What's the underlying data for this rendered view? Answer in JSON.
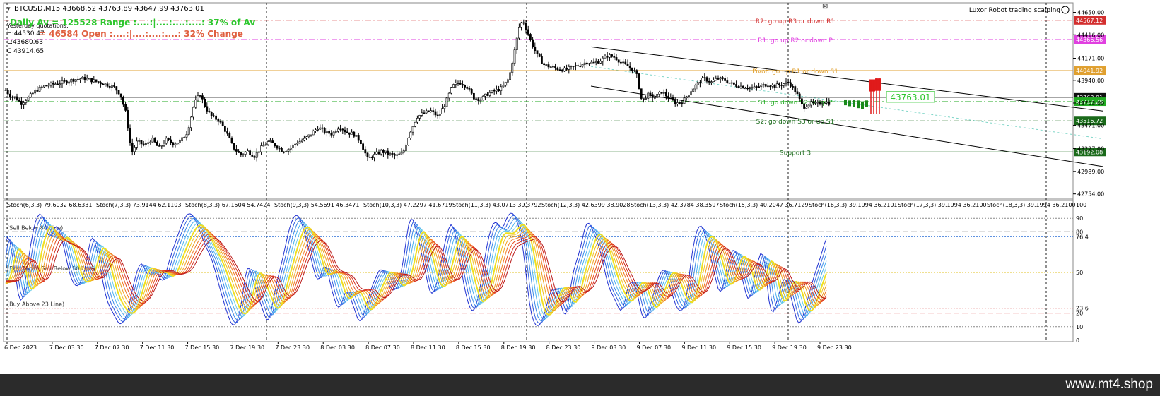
{
  "window": {
    "title": "BTCUSD,M15  43668.52 43763.89 43647.99 43763.01",
    "indicator_name": "Luxor Robot trading scalping",
    "smile_icon": "smile-icon",
    "close_icon": "close-icon",
    "dropdown_icon": "triangle-down-icon"
  },
  "overlay": {
    "yesterday_label": "Yesterday quotations:",
    "high": "H:44530.47",
    "low": "L:43680.63",
    "close": "C 43914.65",
    "line1": "Daily Av = 125528  Range :....:|....:....:....:  37% of Av",
    "line2": "= 46584  Open :....:|....:....:....:  32% Change"
  },
  "colors": {
    "resistance": "#d32f2f",
    "magenta": "#e040e0",
    "pivot": "#e0a030",
    "support": "#22aa22",
    "support_dark": "#1a6a1a",
    "current": "#111111",
    "accent_green": "#2ec62e"
  },
  "levels": [
    {
      "id": "r2",
      "price": 44567.12,
      "tag": "44567.12",
      "label": "R2: go up R3 or down R1",
      "color": "#d32f2f",
      "style": "dashdot"
    },
    {
      "id": "r1",
      "price": 44366.56,
      "tag": "44366.56",
      "label": "R1: go up R2 or down P",
      "color": "#e040e0",
      "style": "dashdot"
    },
    {
      "id": "pivot",
      "price": 44041.92,
      "tag": "44041.92",
      "label": "Pivot: go up R1 or down S1",
      "color": "#e0a030",
      "style": "solid"
    },
    {
      "id": "current",
      "price": 43763.01,
      "tag": "43763.01",
      "label": "",
      "color": "#111111",
      "style": "solid"
    },
    {
      "id": "s1",
      "price": 43717.28,
      "tag": "43717.28",
      "label": "S1: go down S2 or up P",
      "color": "#22aa22",
      "style": "dashdot"
    },
    {
      "id": "s2",
      "price": 43516.72,
      "tag": "43516.72",
      "label": "S2: go down S3 or up S1",
      "color": "#1a6a1a",
      "style": "dashdot"
    },
    {
      "id": "s3",
      "price": 43192.08,
      "tag": "43192.08",
      "label": "Support 3",
      "color": "#1a6a1a",
      "style": "solid"
    }
  ],
  "price_box": "43763.01",
  "chart_data": [
    {
      "type": "candlestick",
      "title": "BTCUSD,M15",
      "ylim": [
        42700,
        44750
      ],
      "y_ticks": [
        44650.0,
        44416.0,
        44171.0,
        43940.0,
        43703.0,
        43471.0,
        43227.0,
        42989.0,
        42754.0
      ],
      "x_labels": [
        "6 Dec 2023",
        "7 Dec 03:30",
        "7 Dec 07:30",
        "7 Dec 11:30",
        "7 Dec 15:30",
        "7 Dec 19:30",
        "7 Dec 23:30",
        "8 Dec 03:30",
        "8 Dec 07:30",
        "8 Dec 11:30",
        "8 Dec 15:30",
        "8 Dec 19:30",
        "8 Dec 23:30",
        "9 Dec 03:30",
        "9 Dec 07:30",
        "9 Dec 11:30",
        "9 Dec 15:30",
        "9 Dec 19:30",
        "9 Dec 23:30"
      ],
      "close_path": [
        [
          0,
          43770
        ],
        [
          8,
          43840
        ],
        [
          14,
          43780
        ],
        [
          22,
          43760
        ],
        [
          30,
          43700
        ],
        [
          40,
          43760
        ],
        [
          50,
          43830
        ],
        [
          62,
          43880
        ],
        [
          75,
          43900
        ],
        [
          90,
          43920
        ],
        [
          105,
          43950
        ],
        [
          120,
          43960
        ],
        [
          135,
          43930
        ],
        [
          148,
          43900
        ],
        [
          160,
          43880
        ],
        [
          170,
          43800
        ],
        [
          178,
          43600
        ],
        [
          186,
          43180
        ],
        [
          194,
          43300
        ],
        [
          205,
          43260
        ],
        [
          215,
          43330
        ],
        [
          225,
          43230
        ],
        [
          235,
          43320
        ],
        [
          245,
          43280
        ],
        [
          255,
          43300
        ],
        [
          265,
          43400
        ],
        [
          275,
          43700
        ],
        [
          283,
          43800
        ],
        [
          291,
          43650
        ],
        [
          300,
          43560
        ],
        [
          310,
          43520
        ],
        [
          320,
          43400
        ],
        [
          330,
          43240
        ],
        [
          340,
          43160
        ],
        [
          350,
          43200
        ],
        [
          360,
          43150
        ],
        [
          370,
          43240
        ],
        [
          380,
          43300
        ],
        [
          390,
          43260
        ],
        [
          400,
          43200
        ],
        [
          410,
          43230
        ],
        [
          420,
          43290
        ],
        [
          430,
          43320
        ],
        [
          440,
          43380
        ],
        [
          450,
          43450
        ],
        [
          460,
          43400
        ],
        [
          470,
          43380
        ],
        [
          480,
          43460
        ],
        [
          490,
          43400
        ],
        [
          500,
          43380
        ],
        [
          510,
          43300
        ],
        [
          520,
          43120
        ],
        [
          530,
          43160
        ],
        [
          540,
          43200
        ],
        [
          550,
          43170
        ],
        [
          560,
          43150
        ],
        [
          570,
          43180
        ],
        [
          580,
          43400
        ],
        [
          590,
          43560
        ],
        [
          600,
          43600
        ],
        [
          610,
          43620
        ],
        [
          620,
          43560
        ],
        [
          630,
          43700
        ],
        [
          640,
          43880
        ],
        [
          650,
          43920
        ],
        [
          660,
          43880
        ],
        [
          670,
          43760
        ],
        [
          680,
          43740
        ],
        [
          690,
          43800
        ],
        [
          700,
          43830
        ],
        [
          710,
          43860
        ],
        [
          720,
          43960
        ],
        [
          728,
          44250
        ],
        [
          735,
          44520
        ],
        [
          740,
          44560
        ],
        [
          746,
          44450
        ],
        [
          752,
          44330
        ],
        [
          760,
          44200
        ],
        [
          770,
          44100
        ],
        [
          780,
          44080
        ],
        [
          790,
          44060
        ],
        [
          800,
          44050
        ],
        [
          810,
          44080
        ],
        [
          820,
          44100
        ],
        [
          830,
          44130
        ],
        [
          840,
          44120
        ],
        [
          850,
          44150
        ],
        [
          860,
          44200
        ],
        [
          870,
          44180
        ],
        [
          880,
          44120
        ],
        [
          890,
          44080
        ],
        [
          900,
          44020
        ],
        [
          908,
          43720
        ],
        [
          916,
          43790
        ],
        [
          926,
          43760
        ],
        [
          936,
          43820
        ],
        [
          946,
          43760
        ],
        [
          956,
          43700
        ],
        [
          966,
          43720
        ],
        [
          976,
          43820
        ],
        [
          986,
          43900
        ],
        [
          996,
          43960
        ],
        [
          1006,
          43920
        ],
        [
          1016,
          43960
        ],
        [
          1026,
          43940
        ],
        [
          1036,
          43900
        ],
        [
          1046,
          43880
        ],
        [
          1056,
          43870
        ],
        [
          1066,
          43860
        ],
        [
          1076,
          43880
        ],
        [
          1086,
          43900
        ],
        [
          1096,
          43880
        ],
        [
          1106,
          43900
        ],
        [
          1116,
          43920
        ],
        [
          1126,
          43820
        ],
        [
          1136,
          43660
        ],
        [
          1146,
          43700
        ],
        [
          1156,
          43690
        ],
        [
          1166,
          43720
        ],
        [
          1175,
          43700
        ]
      ],
      "signal_bars": [
        {
          "x": 1196,
          "low": 43680,
          "high": 43740,
          "color": "#1a8a1a"
        },
        {
          "x": 1202,
          "low": 43670,
          "high": 43730,
          "color": "#1a8a1a"
        },
        {
          "x": 1208,
          "low": 43660,
          "high": 43740,
          "color": "#1a8a1a"
        },
        {
          "x": 1214,
          "low": 43650,
          "high": 43730,
          "color": "#1a8a1a"
        },
        {
          "x": 1220,
          "low": 43640,
          "high": 43720,
          "color": "#1a8a1a"
        },
        {
          "x": 1226,
          "low": 43660,
          "high": 43730,
          "color": "#1a8a1a"
        },
        {
          "x": 1234,
          "low": 43590,
          "high": 43950,
          "color": "#e01b1b"
        },
        {
          "x": 1242,
          "low": 43590,
          "high": 43960,
          "color": "#e01b1b"
        }
      ],
      "channel": {
        "upper": [
          [
            836,
            44290
          ],
          [
            1560,
            43620
          ]
        ],
        "lower": [
          [
            836,
            43880
          ],
          [
            1560,
            43040
          ]
        ],
        "mid": [
          [
            836,
            44085
          ],
          [
            1560,
            43330
          ]
        ]
      }
    },
    {
      "type": "line",
      "title": "Stochastic ribbon",
      "ylim": [
        0,
        100
      ],
      "y_ticks": [
        100,
        90,
        80,
        76.4,
        50,
        23.6,
        20,
        10,
        0
      ],
      "stoch_headers": [
        "Stoch(6,3,3) 79.6032 68.6331",
        "Stoch(7,3,3) 73.9144 62.1103",
        "Stoch(8,3,3) 67.1504 54.7424",
        "Stoch(9,3,3) 54.5691 46.3471",
        "Stoch(10,3,3) 47.2297 41.6719",
        "Stoch(11,3,3) 43.0713 39.3792",
        "Stoch(12,3,3) 42.6399 38.9028",
        "Stoch(13,3,3) 42.3784 38.3597",
        "Stoch(15,3,3) 40.2047 36.7129",
        "Stoch(16,3,3) 39.1994 36.2101",
        "Stoch(17,3,3) 39.1994 36.2100",
        "Stoch(18,3,3) 39.1994 36.2100"
      ],
      "line_labels": {
        "sell_below": "Sell Below 80 Line",
        "buy_above_sell_below": "Buy Above Sell Below 50 Line",
        "buy_above": "Buy Above 23 Line"
      },
      "fast_path": [
        [
          0,
          40
        ],
        [
          10,
          85
        ],
        [
          20,
          55
        ],
        [
          30,
          20
        ],
        [
          40,
          60
        ],
        [
          50,
          90
        ],
        [
          60,
          95
        ],
        [
          70,
          72
        ],
        [
          80,
          88
        ],
        [
          90,
          70
        ],
        [
          100,
          45
        ],
        [
          110,
          38
        ],
        [
          120,
          50
        ],
        [
          130,
          82
        ],
        [
          140,
          60
        ],
        [
          150,
          30
        ],
        [
          160,
          20
        ],
        [
          170,
          10
        ],
        [
          180,
          18
        ],
        [
          190,
          45
        ],
        [
          200,
          60
        ],
        [
          210,
          45
        ],
        [
          220,
          55
        ],
        [
          230,
          40
        ],
        [
          240,
          60
        ],
        [
          250,
          75
        ],
        [
          260,
          90
        ],
        [
          270,
          95
        ],
        [
          280,
          85
        ],
        [
          290,
          70
        ],
        [
          300,
          60
        ],
        [
          310,
          40
        ],
        [
          320,
          22
        ],
        [
          330,
          8
        ],
        [
          340,
          20
        ],
        [
          350,
          60
        ],
        [
          360,
          40
        ],
        [
          370,
          25
        ],
        [
          380,
          10
        ],
        [
          390,
          40
        ],
        [
          400,
          60
        ],
        [
          410,
          85
        ],
        [
          420,
          95
        ],
        [
          430,
          82
        ],
        [
          440,
          60
        ],
        [
          450,
          40
        ],
        [
          460,
          60
        ],
        [
          470,
          35
        ],
        [
          480,
          20
        ],
        [
          490,
          40
        ],
        [
          500,
          25
        ],
        [
          510,
          10
        ],
        [
          520,
          30
        ],
        [
          530,
          45
        ],
        [
          540,
          55
        ],
        [
          550,
          40
        ],
        [
          560,
          35
        ],
        [
          570,
          55
        ],
        [
          580,
          95
        ],
        [
          590,
          80
        ],
        [
          600,
          55
        ],
        [
          610,
          30
        ],
        [
          620,
          45
        ],
        [
          630,
          75
        ],
        [
          640,
          90
        ],
        [
          650,
          60
        ],
        [
          660,
          30
        ],
        [
          670,
          18
        ],
        [
          680,
          40
        ],
        [
          690,
          75
        ],
        [
          700,
          90
        ],
        [
          710,
          80
        ],
        [
          720,
          95
        ],
        [
          730,
          92
        ],
        [
          740,
          70
        ],
        [
          750,
          20
        ],
        [
          760,
          8
        ],
        [
          770,
          18
        ],
        [
          780,
          40
        ],
        [
          790,
          35
        ],
        [
          800,
          12
        ],
        [
          810,
          50
        ],
        [
          820,
          65
        ],
        [
          830,
          90
        ],
        [
          840,
          80
        ],
        [
          850,
          65
        ],
        [
          860,
          40
        ],
        [
          870,
          30
        ],
        [
          880,
          18
        ],
        [
          890,
          45
        ],
        [
          900,
          40
        ],
        [
          910,
          12
        ],
        [
          920,
          25
        ],
        [
          930,
          45
        ],
        [
          940,
          55
        ],
        [
          950,
          35
        ],
        [
          960,
          20
        ],
        [
          970,
          25
        ],
        [
          980,
          70
        ],
        [
          990,
          88
        ],
        [
          1000,
          75
        ],
        [
          1010,
          50
        ],
        [
          1020,
          30
        ],
        [
          1030,
          60
        ],
        [
          1040,
          70
        ],
        [
          1050,
          45
        ],
        [
          1060,
          25
        ],
        [
          1070,
          55
        ],
        [
          1080,
          70
        ],
        [
          1090,
          15
        ],
        [
          1100,
          30
        ],
        [
          1110,
          50
        ],
        [
          1120,
          30
        ],
        [
          1130,
          8
        ],
        [
          1140,
          25
        ],
        [
          1150,
          45
        ],
        [
          1160,
          60
        ],
        [
          1170,
          78
        ]
      ]
    }
  ]
}
